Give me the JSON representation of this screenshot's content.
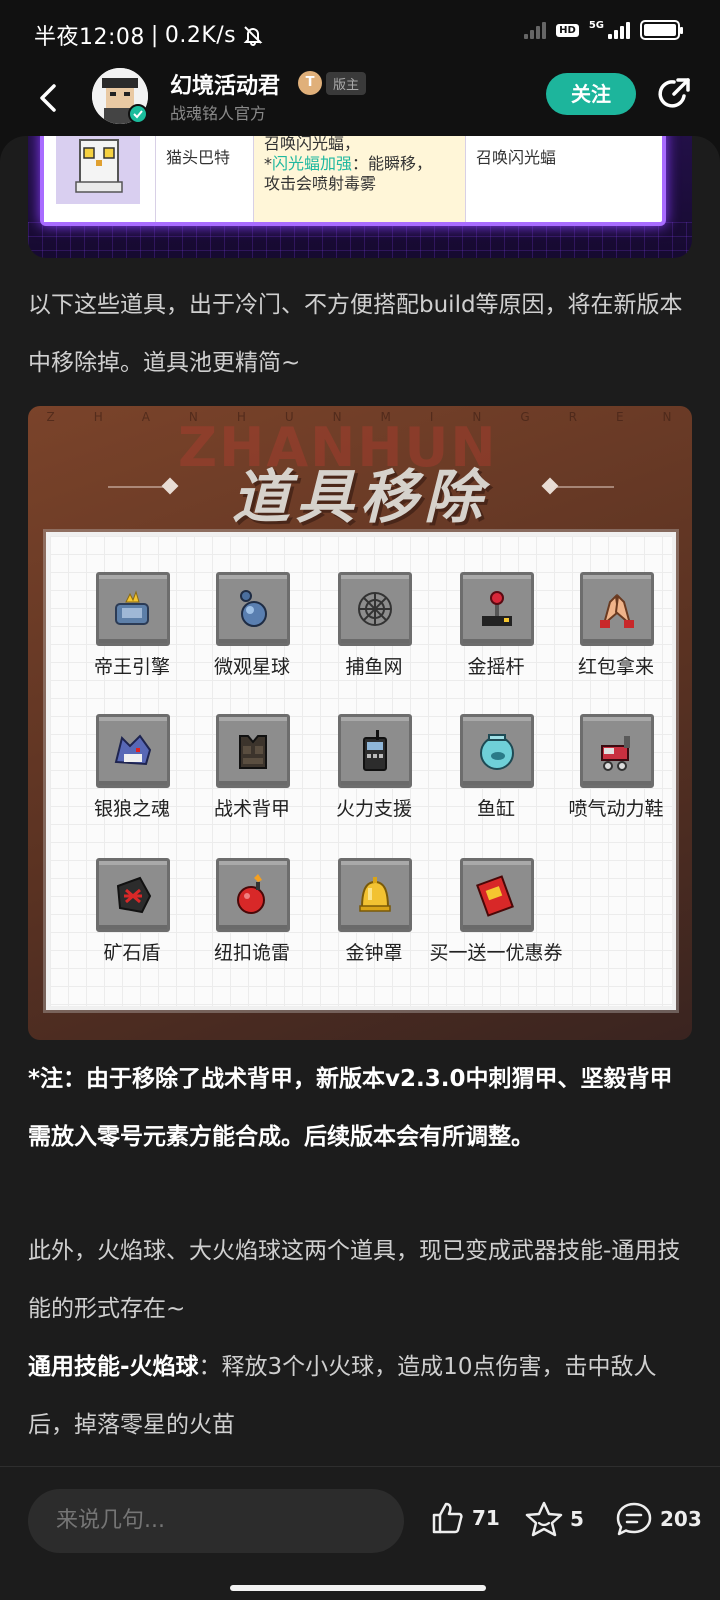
{
  "status_bar": {
    "time_label": "半夜12:08",
    "net_speed": "0.2K/s",
    "hd": "HD",
    "net_type": "5G"
  },
  "header": {
    "author_name": "幻境活动君",
    "level_badge": "T",
    "role_badge": "版主",
    "author_sub": "战魂铭人官方",
    "follow_label": "关注"
  },
  "table": {
    "name": "猫头巴特",
    "desc_line1": "召唤闪光蝠，",
    "desc_prefix": "*",
    "desc_highlight": "闪光蝠加强",
    "desc_line2_rest": "：能瞬移，",
    "desc_line3": "攻击会喷射毒雾",
    "effect": "召唤闪光蝠"
  },
  "paragraphs": {
    "p1": "以下这些道具，出于冷门、不方便搭配build等原因，将在新版本中移除掉。道具池更精简~",
    "note": "*注：由于移除了战术背甲，新版本v2.3.0中刺猬甲、坚毅背甲需放入零号元素方能合成。后续版本会有所调整。",
    "p2": "此外，火焰球、大火焰球这两个道具，现已变成武器技能-通用技能的形式存在~",
    "p3_bold": "通用技能-火焰球",
    "p3_rest": "：释放3个小火球，造成10点伤害，击中敌人后，掉落零星的火苗"
  },
  "poster": {
    "letters": [
      "Z",
      "H",
      "A",
      "N",
      "H",
      "U",
      "N",
      "M",
      "I",
      "N",
      "G",
      "R",
      "E",
      "N"
    ],
    "bg_text": "ZHANHUN",
    "title": "道具移除",
    "items": [
      {
        "label": "帝王引擎",
        "icon": "engine-icon"
      },
      {
        "label": "微观星球",
        "icon": "planet-icon"
      },
      {
        "label": "捕鱼网",
        "icon": "net-icon"
      },
      {
        "label": "金摇杆",
        "icon": "joystick-icon"
      },
      {
        "label": "红包拿来",
        "icon": "hands-icon"
      },
      {
        "label": "银狼之魂",
        "icon": "wolf-icon"
      },
      {
        "label": "战术背甲",
        "icon": "vest-icon"
      },
      {
        "label": "火力支援",
        "icon": "radio-icon"
      },
      {
        "label": "鱼缸",
        "icon": "fishbowl-icon"
      },
      {
        "label": "喷气动力鞋",
        "icon": "jet-shoe-icon"
      },
      {
        "label": "矿石盾",
        "icon": "ore-shield-icon"
      },
      {
        "label": "纽扣诡雷",
        "icon": "bomb-icon"
      },
      {
        "label": "金钟罩",
        "icon": "golden-bell-icon"
      },
      {
        "label": "买一送一优惠券",
        "icon": "coupon-icon"
      }
    ]
  },
  "bottom_bar": {
    "comment_placeholder": "来说几句...",
    "like_count": "71",
    "fav_count": "5",
    "comment_count": "203"
  }
}
